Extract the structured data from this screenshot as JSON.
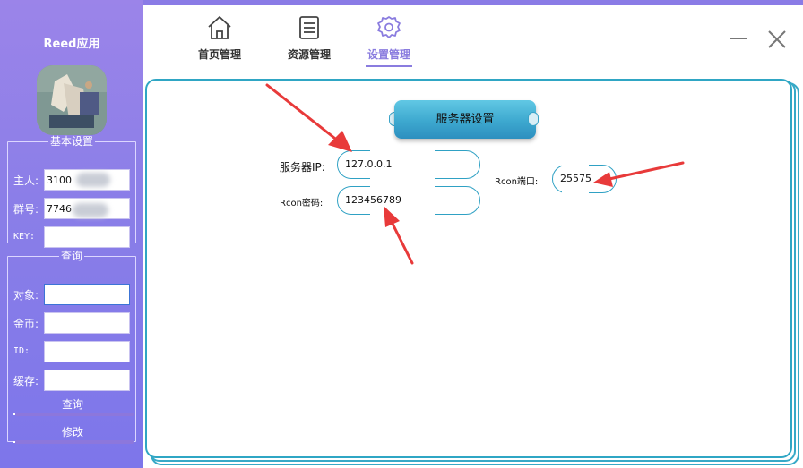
{
  "app": {
    "title": "Reed应用"
  },
  "sidebar": {
    "basic_group": {
      "legend": "基本设置",
      "owner": {
        "label": "主人:",
        "value": "3100"
      },
      "group_no": {
        "label": "群号:",
        "value": "7746"
      },
      "key": {
        "label": "KEY:",
        "value": ""
      }
    },
    "query_group": {
      "legend": "查询",
      "target": {
        "label": "对象:",
        "value": ""
      },
      "gold": {
        "label": "金币:",
        "value": ""
      },
      "id": {
        "label": "ID:",
        "value": ""
      },
      "cache": {
        "label": "缓存:",
        "value": ""
      },
      "query_button": "查询",
      "modify_button": "修改"
    }
  },
  "nav": {
    "tabs": [
      {
        "label": "首页管理",
        "icon": "home-icon",
        "active": false
      },
      {
        "label": "资源管理",
        "icon": "list-icon",
        "active": false
      },
      {
        "label": "设置管理",
        "icon": "gear-icon",
        "active": true
      }
    ]
  },
  "window": {
    "controls": [
      "minimize-icon",
      "close-icon"
    ]
  },
  "settings": {
    "title": "服务器设置",
    "server_ip": {
      "label": "服务器IP:",
      "value": "127.0.0.1"
    },
    "rcon_password": {
      "label": "Rcon密码:",
      "value": "123456789"
    },
    "rcon_port": {
      "label": "Rcon端口:",
      "value": "25575"
    }
  },
  "colors": {
    "sidebar": "#8a7ee8",
    "accent": "#8a7cdf",
    "panel_border": "#2fa6c4",
    "arrow": "#e83a3a"
  }
}
